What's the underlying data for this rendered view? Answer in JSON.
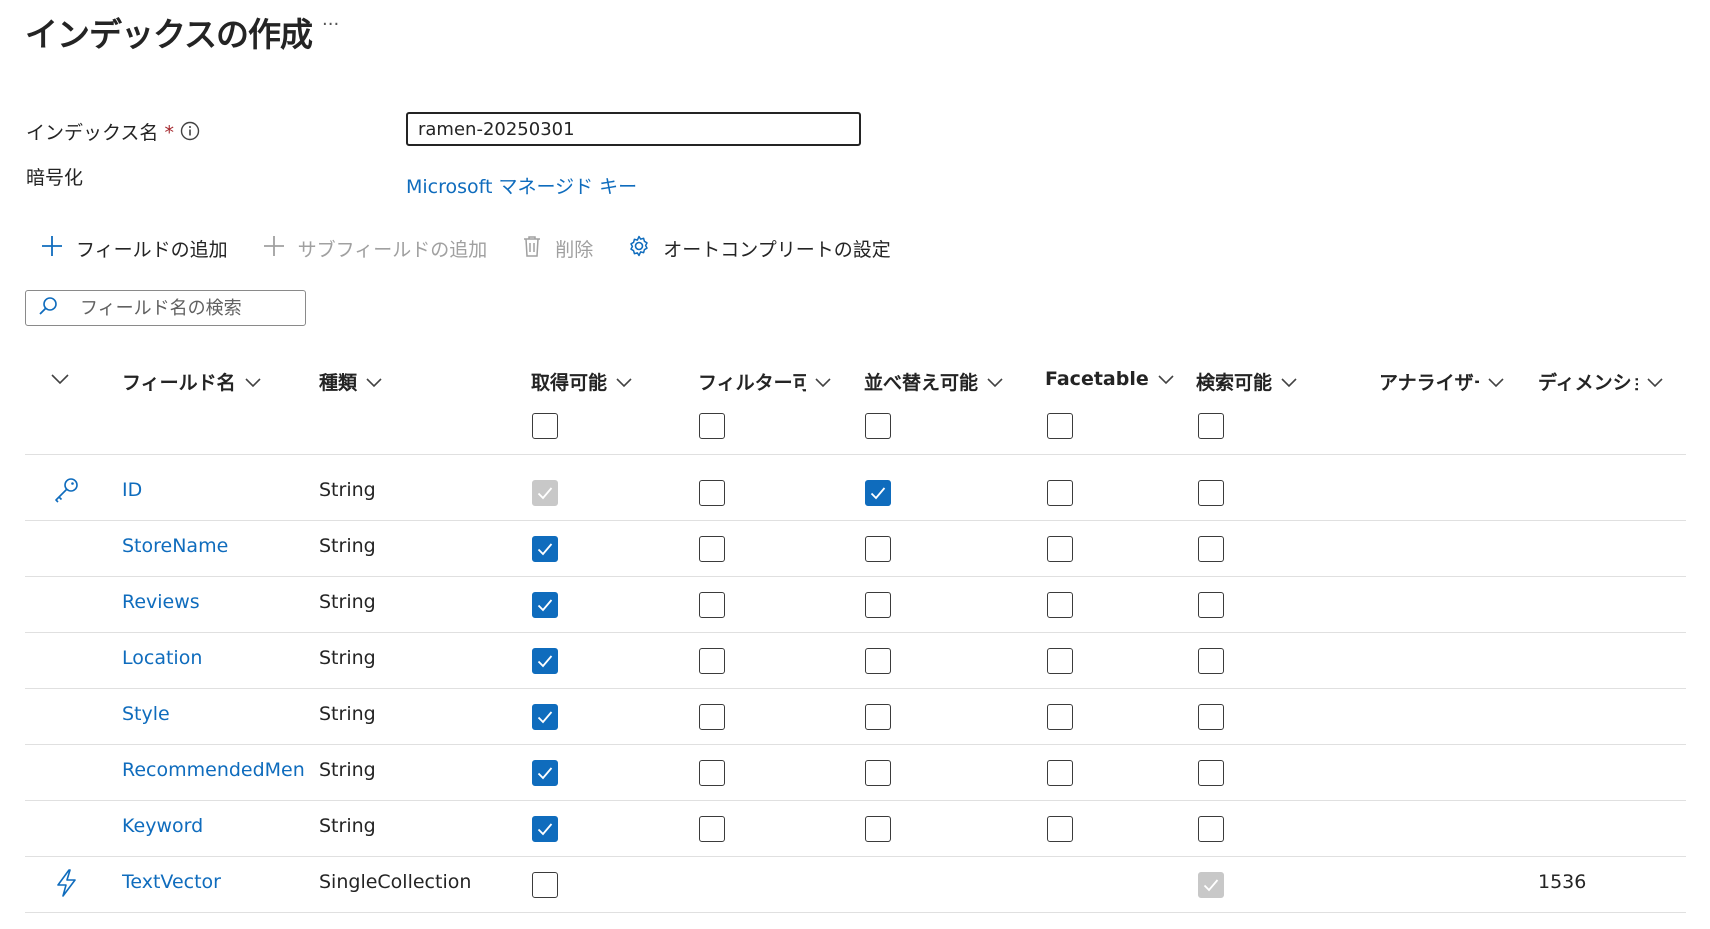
{
  "page": {
    "title": "インデックスの作成",
    "more": "···"
  },
  "form": {
    "index_name_label": "インデックス名",
    "required_mark": "*",
    "index_name_value": "ramen-20250301",
    "encryption_label": "暗号化",
    "encryption_value": "Microsoft マネージド キー"
  },
  "toolbar": {
    "add_field": "フィールドの追加",
    "add_subfield": "サブフィールドの追加",
    "delete": "削除",
    "autocomplete": "オートコンプリートの設定"
  },
  "search": {
    "placeholder": "フィールド名の検索"
  },
  "table": {
    "headers": {
      "field_name": "フィールド名",
      "type": "種類",
      "retrievable": "取得可能",
      "filterable": "フィルター可能",
      "sortable": "並べ替え可能",
      "facetable": "Facetable",
      "searchable": "検索可能",
      "analyzer": "アナライザー",
      "dimensions": "ディメンション"
    },
    "rows": [
      {
        "icon": "key-icon",
        "name": "ID",
        "type": "String",
        "retrievable": "disabled-checked",
        "filterable": "unchecked",
        "sortable": "checked",
        "facetable": "unchecked",
        "searchable": "unchecked",
        "dimensions": ""
      },
      {
        "icon": "",
        "name": "StoreName",
        "type": "String",
        "retrievable": "checked",
        "filterable": "unchecked",
        "sortable": "unchecked",
        "facetable": "unchecked",
        "searchable": "unchecked",
        "dimensions": ""
      },
      {
        "icon": "",
        "name": "Reviews",
        "type": "String",
        "retrievable": "checked",
        "filterable": "unchecked",
        "sortable": "unchecked",
        "facetable": "unchecked",
        "searchable": "unchecked",
        "dimensions": ""
      },
      {
        "icon": "",
        "name": "Location",
        "type": "String",
        "retrievable": "checked",
        "filterable": "unchecked",
        "sortable": "unchecked",
        "facetable": "unchecked",
        "searchable": "unchecked",
        "dimensions": ""
      },
      {
        "icon": "",
        "name": "Style",
        "type": "String",
        "retrievable": "checked",
        "filterable": "unchecked",
        "sortable": "unchecked",
        "facetable": "unchecked",
        "searchable": "unchecked",
        "dimensions": ""
      },
      {
        "icon": "",
        "name": "RecommendedMenu",
        "type": "String",
        "retrievable": "checked",
        "filterable": "unchecked",
        "sortable": "unchecked",
        "facetable": "unchecked",
        "searchable": "unchecked",
        "dimensions": ""
      },
      {
        "icon": "",
        "name": "Keyword",
        "type": "String",
        "retrievable": "checked",
        "filterable": "unchecked",
        "sortable": "unchecked",
        "facetable": "unchecked",
        "searchable": "unchecked",
        "dimensions": ""
      },
      {
        "icon": "lightning-icon",
        "name": "TextVector",
        "type": "SingleCollection",
        "retrievable": "unchecked",
        "filterable": "",
        "sortable": "",
        "facetable": "",
        "searchable": "disabled-checked",
        "dimensions": "1536"
      }
    ]
  },
  "colors": {
    "accent": "#0f6cbd",
    "text": "#242424",
    "disabled": "#c8c8c8",
    "required": "#a4262c"
  }
}
